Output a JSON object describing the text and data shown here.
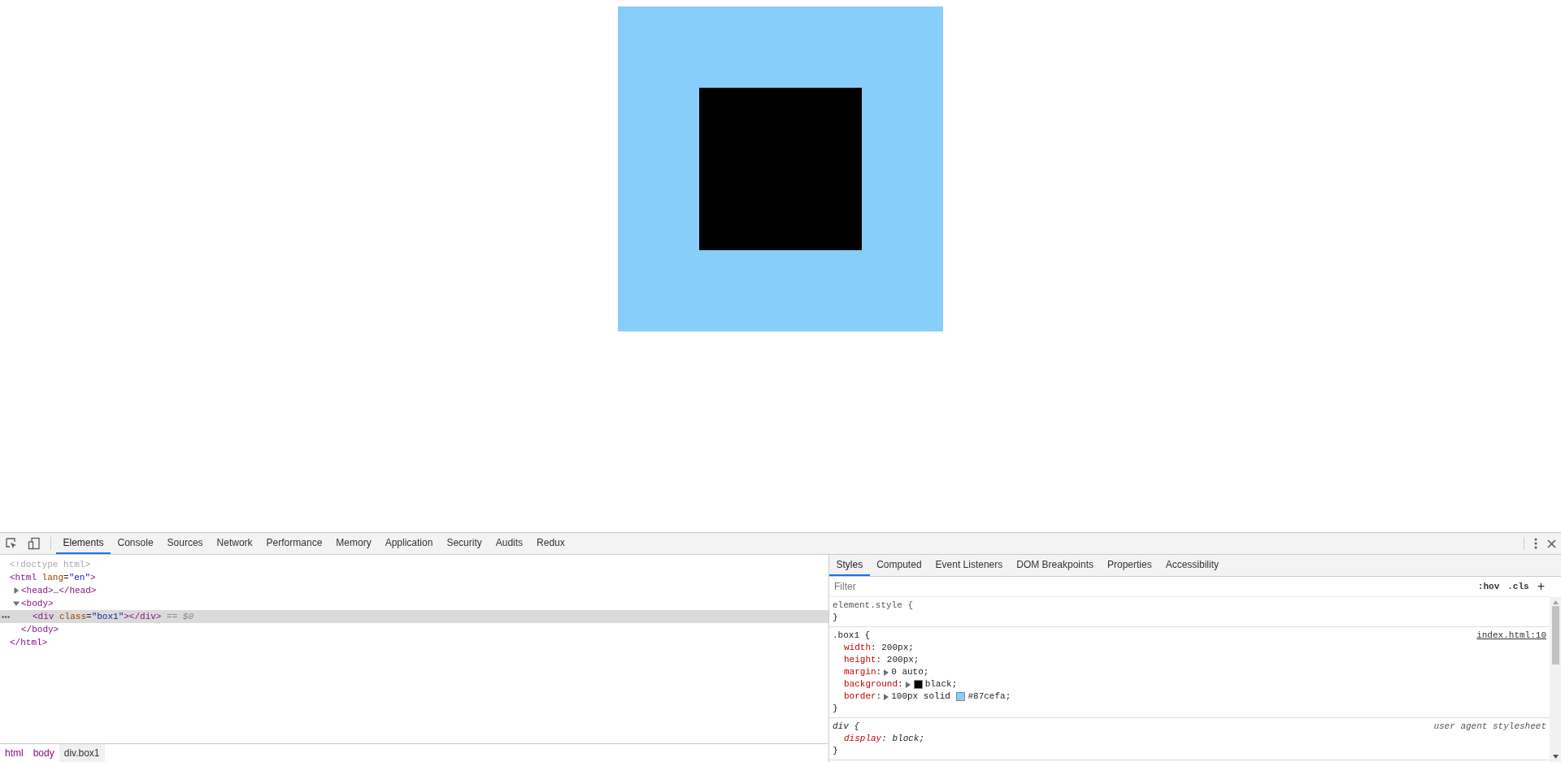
{
  "devtools": {
    "tabs": [
      {
        "label": "Elements",
        "selected": true
      },
      {
        "label": "Console",
        "selected": false
      },
      {
        "label": "Sources",
        "selected": false
      },
      {
        "label": "Network",
        "selected": false
      },
      {
        "label": "Performance",
        "selected": false
      },
      {
        "label": "Memory",
        "selected": false
      },
      {
        "label": "Application",
        "selected": false
      },
      {
        "label": "Security",
        "selected": false
      },
      {
        "label": "Audits",
        "selected": false
      },
      {
        "label": "Redux",
        "selected": false
      }
    ],
    "dom_tree": [
      {
        "selected": false,
        "parts": [
          {
            "kind": "comment",
            "text": "<!doctype html>"
          }
        ]
      },
      {
        "selected": false,
        "parts": [
          {
            "kind": "tag",
            "text": "<html"
          },
          {
            "kind": "attr_name",
            "text": " lang"
          },
          {
            "kind": "plain",
            "text": "="
          },
          {
            "kind": "attr_value",
            "text": "\"en\""
          },
          {
            "kind": "tag",
            "text": ">"
          }
        ],
        "children": [
          {
            "selected": false,
            "expanded": false,
            "parts": [
              {
                "kind": "tag",
                "text": "<head>"
              },
              {
                "kind": "plain",
                "text": "…"
              },
              {
                "kind": "tag",
                "text": "</head>"
              }
            ]
          },
          {
            "selected": false,
            "expanded": true,
            "parts": [
              {
                "kind": "tag",
                "text": "<body>"
              }
            ],
            "children": [
              {
                "selected": true,
                "parts": [
                  {
                    "kind": "tag",
                    "text": "<div"
                  },
                  {
                    "kind": "attr_name",
                    "text": " class"
                  },
                  {
                    "kind": "plain",
                    "text": "="
                  },
                  {
                    "kind": "attr_value",
                    "text": "\"box1\""
                  },
                  {
                    "kind": "tag",
                    "text": "></div>"
                  },
                  {
                    "kind": "marker",
                    "text": " == *$0*"
                  }
                ]
              }
            ],
            "closing": [
              {
                "kind": "tag",
                "text": "</body>"
              }
            ]
          }
        ],
        "closing": [
          {
            "kind": "tag",
            "text": "</html>"
          }
        ]
      }
    ],
    "breadcrumbs": [
      {
        "label": "html",
        "selected": false
      },
      {
        "label": "body",
        "selected": false
      },
      {
        "label": "div.box1",
        "selected": true
      }
    ],
    "styles_panel": {
      "tabs": [
        {
          "label": "Styles",
          "selected": true
        },
        {
          "label": "Computed",
          "selected": false
        },
        {
          "label": "Event Listeners",
          "selected": false
        },
        {
          "label": "DOM Breakpoints",
          "selected": false
        },
        {
          "label": "Properties",
          "selected": false
        },
        {
          "label": "Accessibility",
          "selected": false
        }
      ],
      "filter": {
        "placeholder": "Filter"
      },
      "hov_label": ":hov",
      "cls_label": ".cls",
      "add_label": "+",
      "rules": [
        {
          "kind": "inline",
          "selector": "element.style {",
          "close": "}"
        },
        {
          "kind": "author",
          "selector": ".box1 {",
          "source": "index.html:10",
          "close": "}",
          "properties": [
            {
              "name": "width",
              "colon": ":",
              "value": "200px;",
              "expandable": false
            },
            {
              "name": "height",
              "colon": ":",
              "value": "200px;",
              "expandable": false
            },
            {
              "name": "margin",
              "colon": ":",
              "value": "0 auto;",
              "expandable": true
            },
            {
              "name": "background",
              "colon": ":",
              "value": "black;",
              "expandable": true,
              "color": "#000000"
            },
            {
              "name": "border",
              "colon": ":",
              "value": "100px solid",
              "value_after": "#87cefa;",
              "expandable": true,
              "color": "#87cefa"
            }
          ]
        },
        {
          "kind": "user_agent",
          "selector": "div {",
          "source": "user agent stylesheet",
          "close": "}",
          "properties": [
            {
              "name": "display",
              "colon": ":",
              "value": "block;",
              "expandable": false
            }
          ]
        }
      ]
    }
  }
}
